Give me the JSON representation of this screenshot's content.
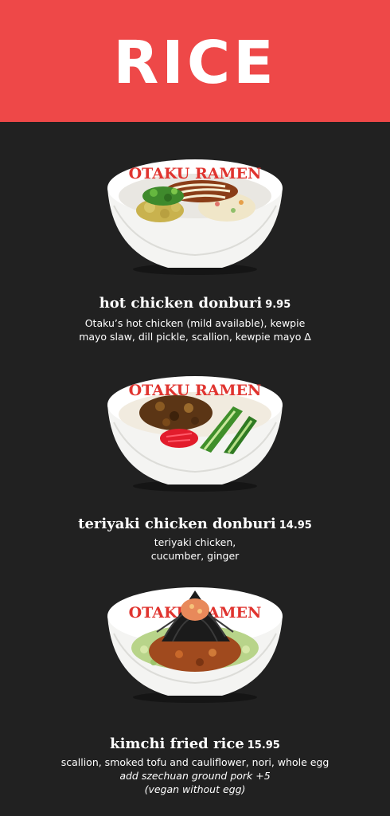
{
  "header": {
    "title": "RICE"
  },
  "bowl_brand": "OTAKU RAMEN",
  "items": [
    {
      "name": "hot chicken donburi",
      "price": "9.95",
      "description_lines": [
        "Otaku’s hot chicken (mild available), kewpie",
        "mayo slaw, dill pickle, scallion, kewpie mayo ∆"
      ]
    },
    {
      "name": "teriyaki chicken donburi",
      "price": "14.95",
      "description_lines": [
        "teriyaki chicken,",
        "cucumber, ginger"
      ]
    },
    {
      "name": "kimchi fried rice",
      "price": "15.95",
      "description_lines": [
        "scallion, smoked tofu and cauliflower, nori, whole egg"
      ],
      "notes": [
        "add szechuan ground pork +5",
        "(vegan without egg)"
      ]
    }
  ],
  "colors": {
    "banner": "#ee4848",
    "background": "#212121",
    "bowl": "#f4f4f2",
    "brand_text": "#e0342f"
  }
}
